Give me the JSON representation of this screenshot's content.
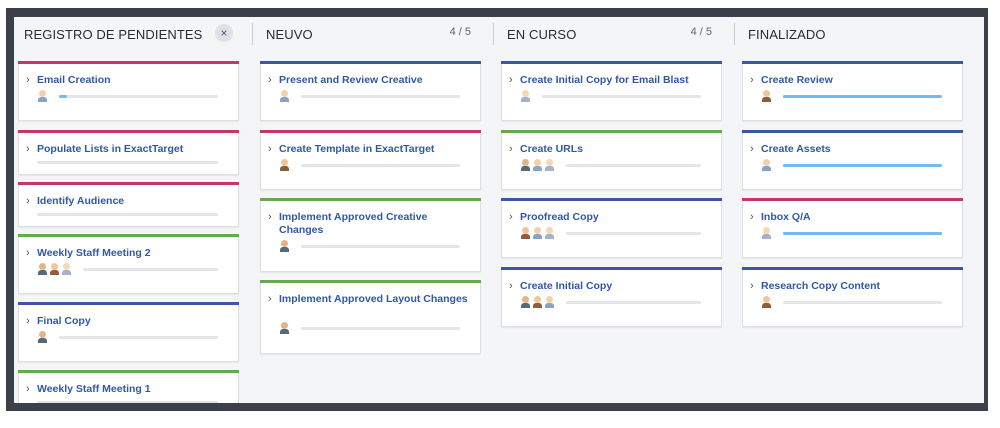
{
  "columns": [
    {
      "title": "REGISTRO DE PENDIENTES",
      "count": "",
      "close_icon": "×",
      "cards": [
        {
          "title": "Email Creation",
          "color": "#c8356a",
          "avatars": [
            "a"
          ],
          "progress": 0.05
        },
        {
          "title": "Populate Lists in ExactTarget",
          "color": "#c8356a",
          "avatars": [],
          "progress": 0
        },
        {
          "title": "Identify Audience",
          "color": "#c8356a",
          "avatars": [],
          "progress": 0
        },
        {
          "title": "Weekly Staff Meeting 2",
          "color": "#66aa4f",
          "avatars": [
            "b",
            "c",
            "d"
          ],
          "progress": 0
        },
        {
          "title": "Final Copy",
          "color": "#3a57a6",
          "avatars": [
            "b"
          ],
          "progress": 0
        },
        {
          "title": "Weekly Staff Meeting 1",
          "color": "#66aa4f",
          "avatars": [],
          "progress": 0
        }
      ]
    },
    {
      "title": "NEUVO",
      "count": "4 / 5",
      "cards": [
        {
          "title": "Present and Review Creative",
          "color": "#3a57a6",
          "avatars": [
            "a"
          ],
          "progress": 0
        },
        {
          "title": "Create Template in ExactTarget",
          "color": "#c8356a",
          "avatars": [
            "c"
          ],
          "progress": 0
        },
        {
          "title": "Implement Approved Creative Changes",
          "color": "#66aa4f",
          "avatars": [
            "b"
          ],
          "progress": 0
        },
        {
          "title": "Implement Approved Layout Changes",
          "color": "#66aa4f",
          "avatars": [
            "b"
          ],
          "progress": 0
        }
      ]
    },
    {
      "title": "EN CURSO",
      "count": "4 / 5",
      "cards": [
        {
          "title": "Create Initial Copy for Email Blast",
          "color": "#3a57a6",
          "avatars": [
            "d"
          ],
          "progress": 0
        },
        {
          "title": "Create URLs",
          "color": "#66aa4f",
          "avatars": [
            "b",
            "a",
            "d"
          ],
          "progress": 0
        },
        {
          "title": "Proofread Copy",
          "color": "#3a57a6",
          "avatars": [
            "c",
            "a",
            "d"
          ],
          "progress": 0
        },
        {
          "title": "Create Initial Copy",
          "color": "#3a57a6",
          "avatars": [
            "b",
            "c",
            "a"
          ],
          "progress": 0
        }
      ]
    },
    {
      "title": "FINALIZADO",
      "count": "",
      "cards": [
        {
          "title": "Create Review",
          "color": "#3a57a6",
          "avatars": [
            "c"
          ],
          "progress": 1
        },
        {
          "title": "Create Assets",
          "color": "#3a57a6",
          "avatars": [
            "a"
          ],
          "progress": 1
        },
        {
          "title": "Inbox Q/A",
          "color": "#c8356a",
          "avatars": [
            "d"
          ],
          "progress": 1
        },
        {
          "title": "Research Copy Content",
          "color": "#3a57a6",
          "avatars": [
            "c"
          ],
          "progress": 0
        }
      ]
    }
  ],
  "icons": {
    "chevron": "chevron-right-icon",
    "close": "close-icon",
    "avatar": "user-avatar-icon"
  }
}
